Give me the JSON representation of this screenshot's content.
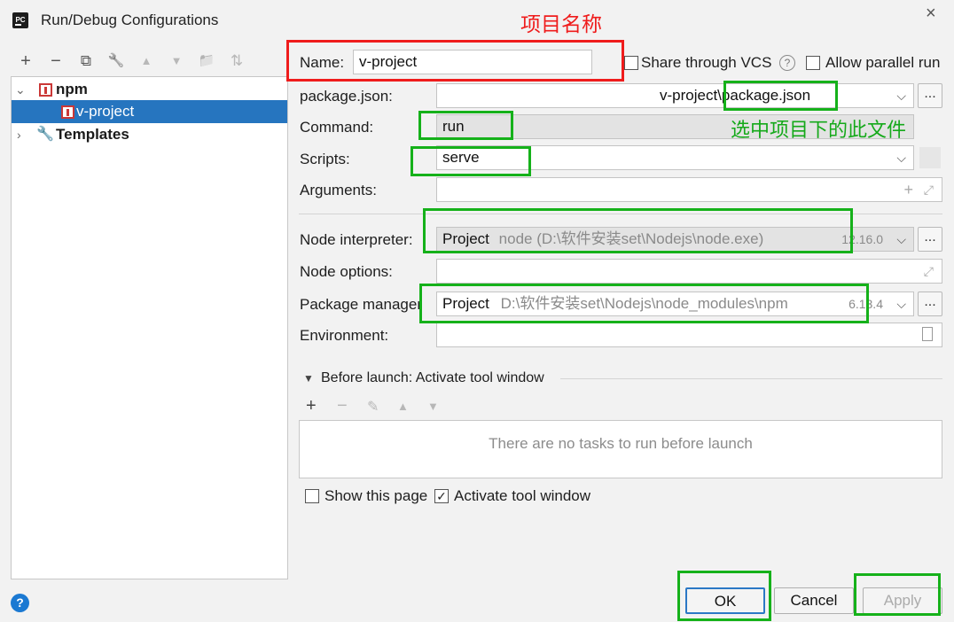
{
  "window": {
    "title": "Run/Debug Configurations",
    "close": "×"
  },
  "toolbar": {
    "add": "+",
    "remove": "−",
    "copy": "⧉",
    "edit": "🔧",
    "up": "▲",
    "down": "▼",
    "folder": "📁",
    "sort": "⇅"
  },
  "tree": {
    "npm_label": "npm",
    "child_label": "v-project",
    "templates_label": "Templates"
  },
  "form": {
    "name_label": "Name:",
    "name_value": "v-project",
    "share_vcs": "Share through VCS",
    "share_checked": false,
    "allow_parallel": "Allow parallel run",
    "allow_checked": false,
    "package_json_label": "package.json:",
    "package_json_value": "v-project\\package.json",
    "command_label": "Command:",
    "command_value": "run",
    "scripts_label": "Scripts:",
    "scripts_value": "serve",
    "arguments_label": "Arguments:",
    "node_interpreter_label": "Node interpreter:",
    "node_interpreter_prefix": "Project",
    "node_interpreter_path": "node (D:\\软件安装set\\Nodejs\\node.exe)",
    "node_interpreter_version": "12.16.0",
    "node_options_label": "Node options:",
    "package_manager_label": "Package manager",
    "package_manager_prefix": "Project",
    "package_manager_path": "D:\\软件安装set\\Nodejs\\node_modules\\npm",
    "package_manager_version": "6.13.4",
    "environment_label": "Environment:",
    "dots": "..."
  },
  "before_launch": {
    "title": "Before launch: Activate tool window",
    "empty_text": "There are no tasks to run before launch",
    "show_page": "Show this page",
    "show_page_checked": false,
    "activate_window": "Activate tool window",
    "activate_checked": true
  },
  "buttons": {
    "ok": "OK",
    "cancel": "Cancel",
    "apply": "Apply",
    "help": "?"
  },
  "annotations": {
    "project_name": "项目名称",
    "select_file": "选中项目下的此文件"
  },
  "colors": {
    "selection": "#2675bf",
    "annotation_red": "#ef1c1c",
    "annotation_green": "#15b11a"
  }
}
